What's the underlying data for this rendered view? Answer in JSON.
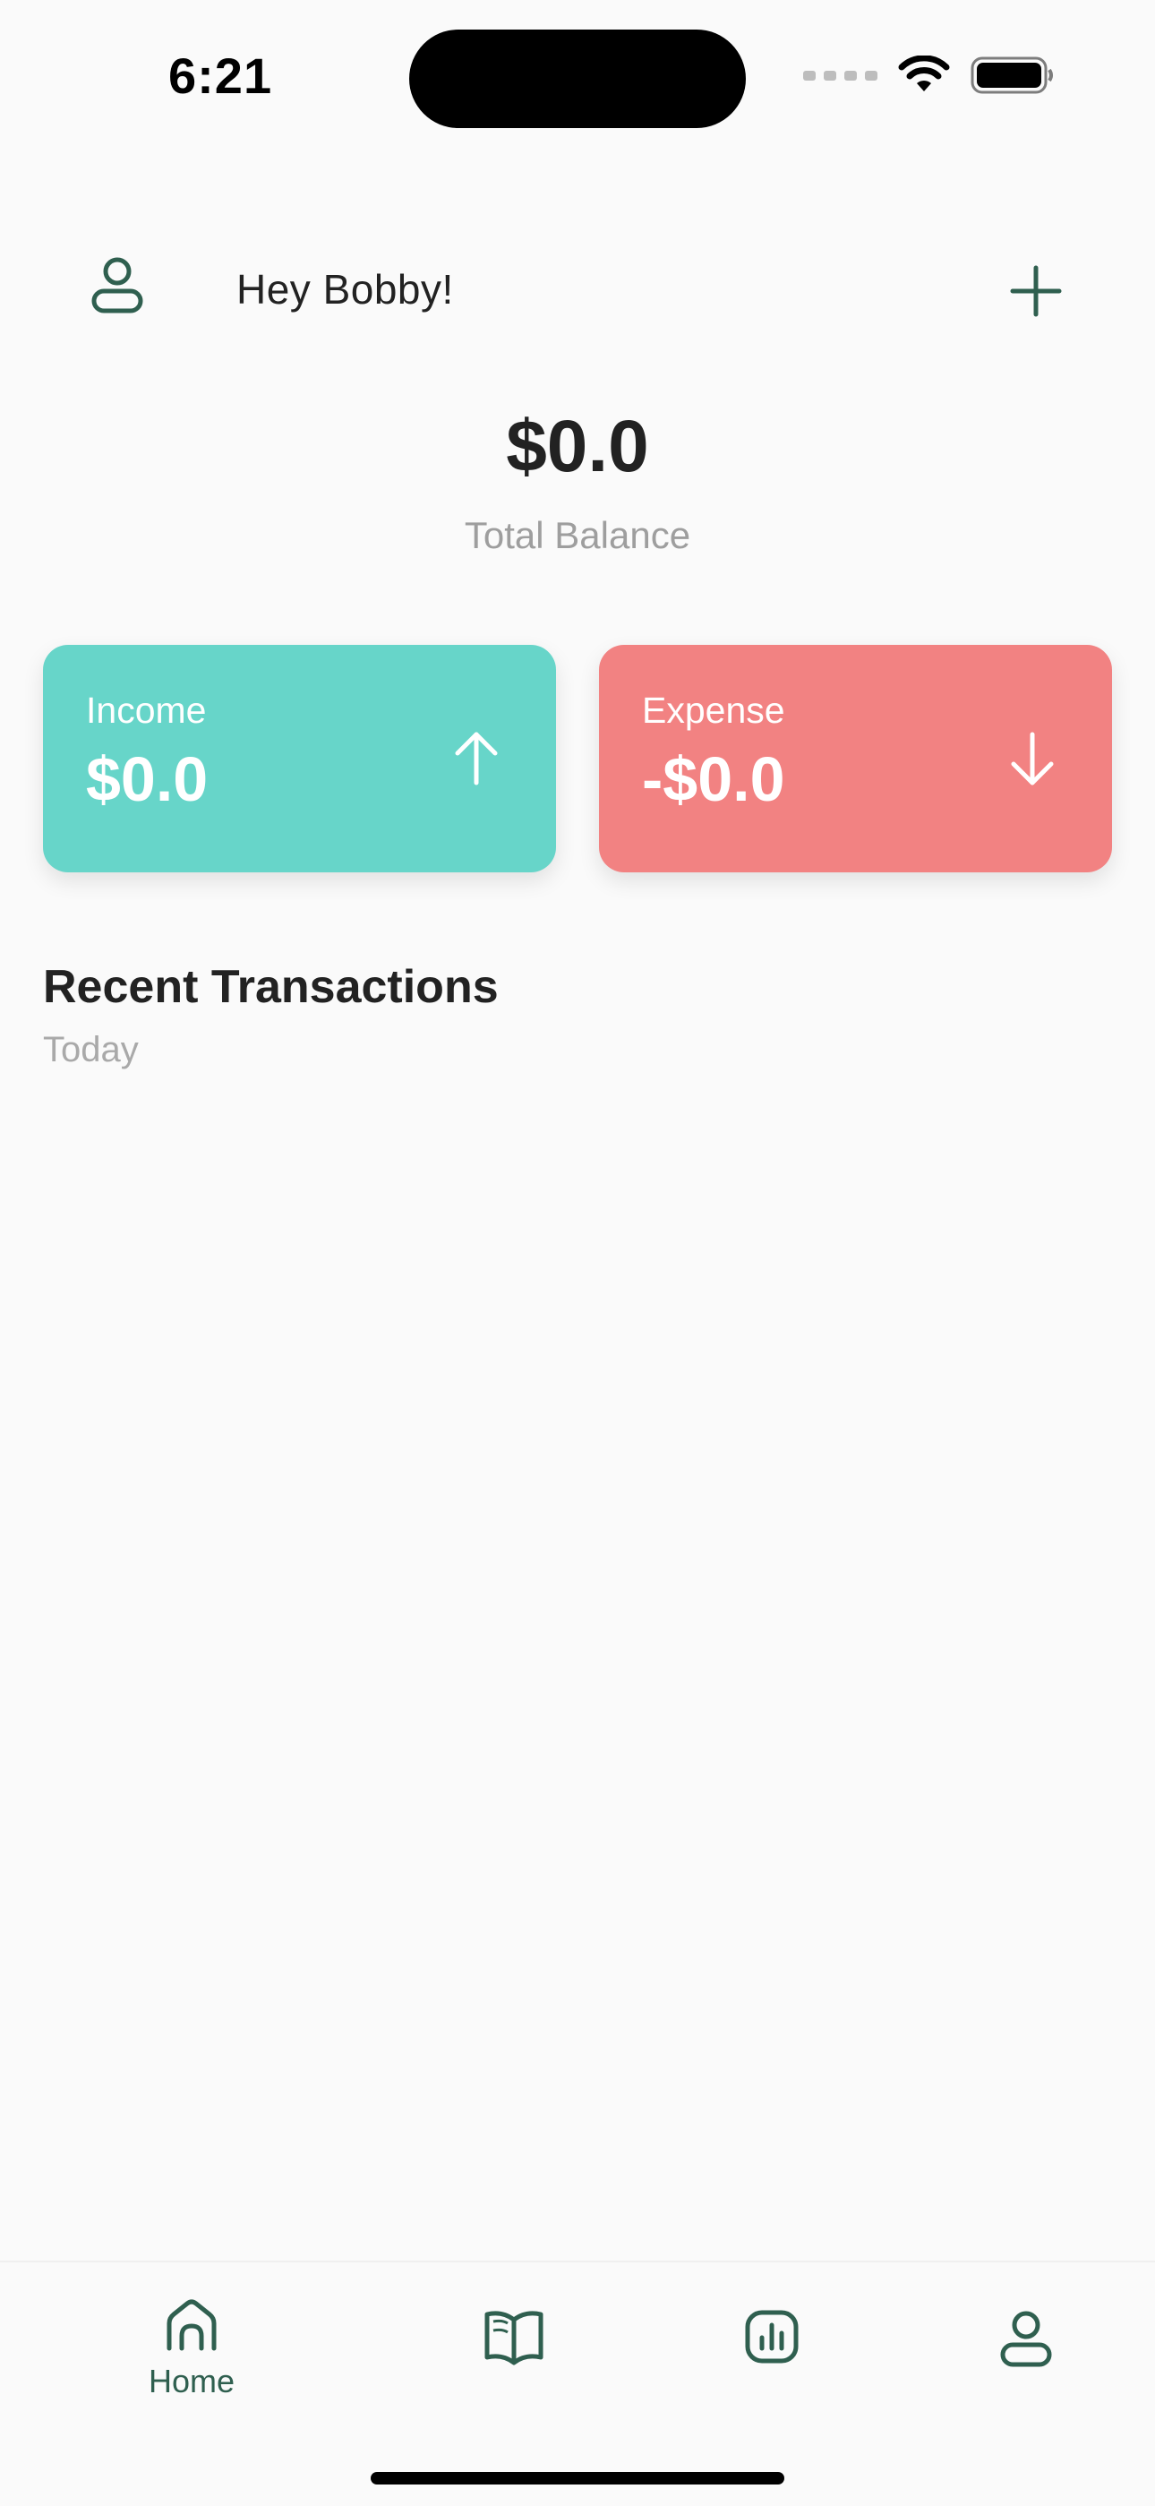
{
  "status_bar": {
    "time": "6:21"
  },
  "header": {
    "greeting": "Hey Bobby!",
    "avatar_icon": "user-icon",
    "add_icon": "plus-icon"
  },
  "balance": {
    "amount": "$0.0",
    "label": "Total Balance"
  },
  "cards": {
    "income": {
      "label": "Income",
      "amount": "$0.0",
      "icon": "arrow-up-icon",
      "color": "#67d5c9"
    },
    "expense": {
      "label": "Expense",
      "amount": "-$0.0",
      "icon": "arrow-down-icon",
      "color": "#f28282"
    }
  },
  "recent": {
    "title": "Recent Transactions",
    "subtitle": "Today"
  },
  "bottom_nav": {
    "items": [
      {
        "label": "Home",
        "icon": "home-icon",
        "active": true
      },
      {
        "label": "",
        "icon": "book-icon",
        "active": false
      },
      {
        "label": "",
        "icon": "chart-icon",
        "active": false
      },
      {
        "label": "",
        "icon": "profile-icon",
        "active": false
      }
    ]
  },
  "colors": {
    "accent": "#2f5f4f",
    "background": "#fafafa",
    "text_primary": "#222222",
    "text_secondary": "#9e9e9e"
  }
}
